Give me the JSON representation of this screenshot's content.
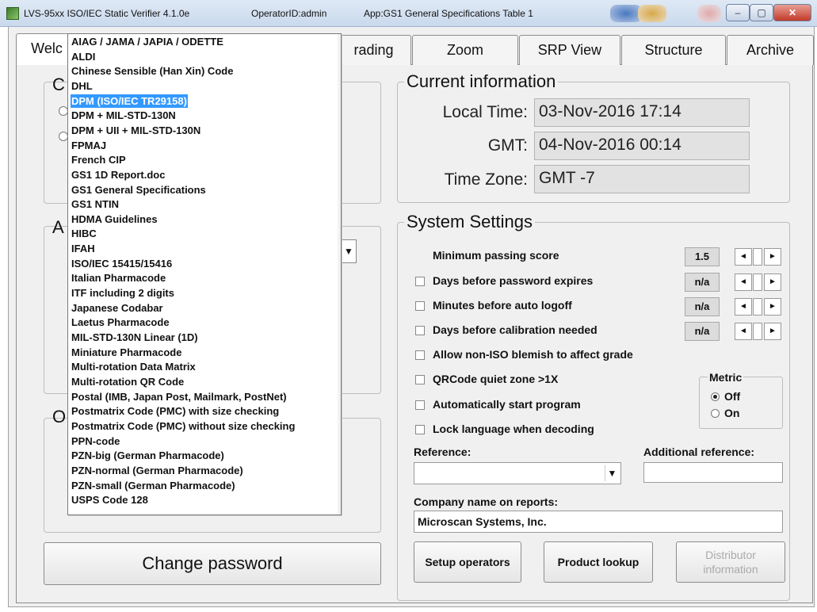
{
  "titlebar": {
    "app": "LVS-95xx ISO/IEC Static Verifier 4.1.0e",
    "operator": "OperatorID:admin",
    "program": "App:GS1 General Specifications Table 1"
  },
  "tabs": [
    "Welcome",
    "Grading",
    "Zoom",
    "SRP View",
    "Structure",
    "Archive"
  ],
  "tab_visible": {
    "welcome": "Welc",
    "grading": "rading"
  },
  "left_groups": {
    "g1_initial": "C",
    "g2_initial": "A",
    "g3_initial": "O"
  },
  "current_info": {
    "title": "Current information",
    "local_time_label": "Local Time:",
    "local_time": "03-Nov-2016 17:14",
    "gmt_label": "GMT:",
    "gmt": "04-Nov-2016 00:14",
    "timezone_label": "Time Zone:",
    "timezone": "GMT -7"
  },
  "system": {
    "title": "System Settings",
    "min_score_label": "Minimum passing score",
    "min_score": "1.5",
    "pwd_label": "Days before password expires",
    "pwd_value": "n/a",
    "logoff_label": "Minutes before auto logoff",
    "logoff_value": "n/a",
    "calib_label": "Days before calibration needed",
    "calib_value": "n/a",
    "blemish_label": "Allow non-ISO blemish to affect grade",
    "qr_label": "QRCode quiet zone >1X",
    "autostart_label": "Automatically start program",
    "lock_label": "Lock language when decoding",
    "metric": {
      "title": "Metric",
      "off": "Off",
      "on": "On",
      "selected": "Off"
    },
    "reference_label": "Reference:",
    "reference_value": "",
    "add_reference_label": "Additional reference:",
    "company_label": "Company name on reports:",
    "company_value": "Microscan Systems, Inc."
  },
  "buttons": {
    "setup": "Setup operators",
    "lookup": "Product lookup",
    "distributor_l1": "Distributor",
    "distributor_l2": "information",
    "change_password": "Change password"
  },
  "dropdown": {
    "selected_index": 4,
    "items": [
      "AIAG / JAMA / JAPIA / ODETTE",
      "ALDI",
      "Chinese Sensible (Han Xin) Code",
      "DHL",
      "DPM (ISO/IEC TR29158)",
      "DPM + MIL-STD-130N",
      "DPM + UII + MIL-STD-130N",
      "FPMAJ",
      "French CIP",
      "GS1 1D Report.doc",
      "GS1 General Specifications",
      "GS1 NTIN",
      "HDMA Guidelines",
      "HIBC",
      "IFAH",
      "ISO/IEC 15415/15416",
      "Italian Pharmacode",
      "ITF including 2 digits",
      "Japanese Codabar",
      "Laetus Pharmacode",
      "MIL-STD-130N Linear (1D)",
      "Miniature Pharmacode",
      "Multi-rotation Data Matrix",
      "Multi-rotation QR Code",
      "Postal (IMB, Japan Post, Mailmark, PostNet)",
      "Postmatrix Code (PMC) with size checking",
      "Postmatrix Code (PMC) without size checking",
      "PPN-code",
      "PZN-big (German Pharmacode)",
      "PZN-normal (German Pharmacode)",
      "PZN-small (German Pharmacode)",
      "USPS Code 128"
    ]
  }
}
